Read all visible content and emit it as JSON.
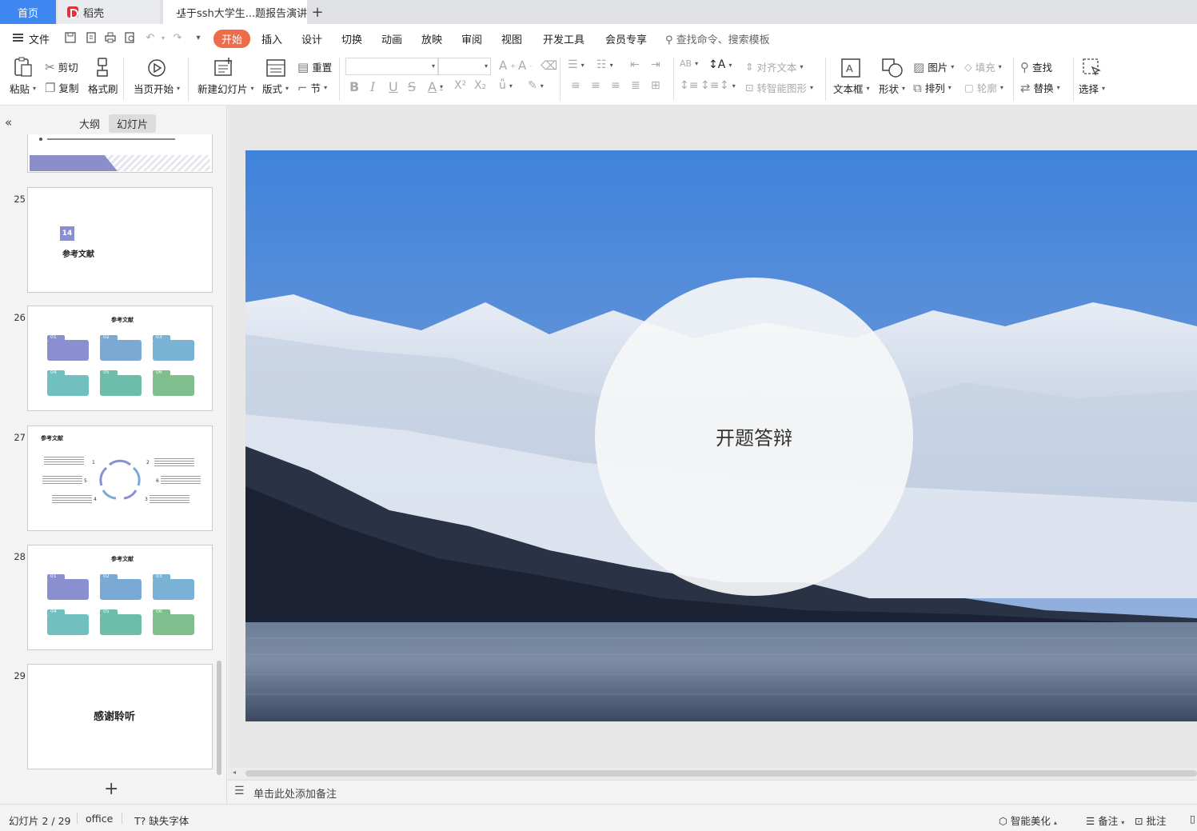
{
  "tabs": {
    "home": "首页",
    "daoke": "稻壳",
    "document": "基于ssh大学生...题报告演讲",
    "plus": "+"
  },
  "menu": {
    "file": "文件",
    "items": [
      "开始",
      "插入",
      "设计",
      "切换",
      "动画",
      "放映",
      "审阅",
      "视图",
      "开发工具",
      "会员专享"
    ],
    "search_placeholder": "查找命令、搜索模板"
  },
  "ribbon": {
    "paste": "粘贴",
    "cut": "剪切",
    "copy": "复制",
    "format_painter": "格式刷",
    "from_current": "当页开始",
    "new_slide": "新建幻灯片",
    "layout": "版式",
    "reset": "重置",
    "section": "节",
    "align_text": "对齐文本",
    "to_smartart": "转智能图形",
    "textbox": "文本框",
    "shape": "形状",
    "picture": "图片",
    "arrange": "排列",
    "fill": "填充",
    "outline": "轮廓",
    "find": "查找",
    "replace": "替换",
    "select": "选择"
  },
  "left_panel": {
    "tab_outline": "大纲",
    "tab_slides": "幻灯片",
    "add": "+"
  },
  "thumbnails": [
    {
      "number": "25",
      "badge": "14",
      "title": "参考文献"
    },
    {
      "number": "26",
      "title": "参考文献",
      "cards": [
        "01",
        "02",
        "03",
        "04",
        "05",
        "06"
      ]
    },
    {
      "number": "27",
      "title": "参考文献",
      "nodes": [
        "1",
        "2",
        "3",
        "4",
        "5",
        "6"
      ]
    },
    {
      "number": "28",
      "title": "参考文献",
      "cards": [
        "01",
        "02",
        "03",
        "04",
        "05",
        "06"
      ]
    },
    {
      "number": "29",
      "title": "感谢聆听"
    }
  ],
  "slide": {
    "title": "开题答辩"
  },
  "notes_placeholder": "单击此处添加备注",
  "status": {
    "slide_counter": "幻灯片 2 / 29",
    "theme": "office",
    "missing_font": "缺失字体",
    "smart_beautify": "智能美化",
    "notes": "备注",
    "comments": "批注"
  },
  "colors": {
    "accent_tab": "#3e86f0",
    "active_menu": "#ef6c4a",
    "card_purple": "#8a8fd0",
    "card_blue": "#7aa9d4",
    "card_teal": "#6fc0bf",
    "card_green": "#7fbf8e"
  }
}
